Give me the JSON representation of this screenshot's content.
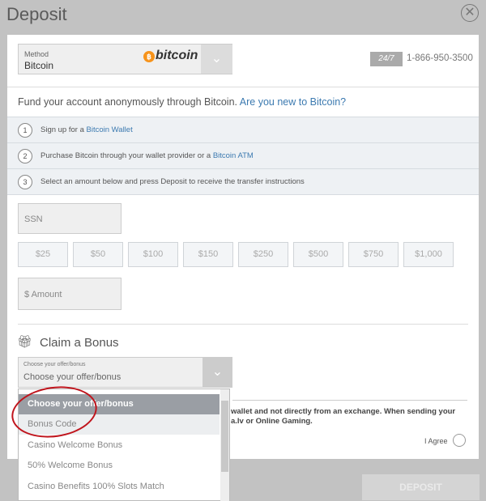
{
  "title": "Deposit",
  "method": {
    "label": "Method",
    "value": "Bitcoin",
    "logo_text": "bitcoin"
  },
  "support": {
    "badge": "24/7",
    "phone": "1-866-950-3500"
  },
  "intro": {
    "text": "Fund your account anonymously through Bitcoin.",
    "link": "Are you new to Bitcoin?"
  },
  "steps": [
    {
      "num": "1",
      "text": "Sign up for a ",
      "link": "Bitcoin Wallet"
    },
    {
      "num": "2",
      "text": "Purchase Bitcoin through your wallet provider or a ",
      "link": "Bitcoin ATM"
    },
    {
      "num": "3",
      "text": "Select an amount below and press Deposit to receive the transfer instructions",
      "link": ""
    }
  ],
  "ssn_placeholder": "SSN",
  "amounts": [
    "$25",
    "$50",
    "$100",
    "$150",
    "$250",
    "$500",
    "$750",
    "$1,000"
  ],
  "amount_placeholder": "$ Amount",
  "bonus": {
    "heading": "Claim a Bonus",
    "select_label": "Choose your offer/bonus",
    "select_value": "Choose your offer/bonus",
    "options": [
      "Choose your offer/bonus",
      "Bonus Code",
      "Casino Welcome Bonus",
      "50% Welcome Bonus",
      "Casino Benefits 100% Slots Match"
    ]
  },
  "notice": {
    "line1": "wallet and not directly from an exchange. When sending your",
    "line2": "a.lv or Online Gaming."
  },
  "agree_label": "I Agree",
  "deposit_label": "DEPOSIT",
  "colors": {
    "link": "#3c7ab0",
    "annotation": "#c0141c",
    "bitcoin": "#f7931a"
  }
}
